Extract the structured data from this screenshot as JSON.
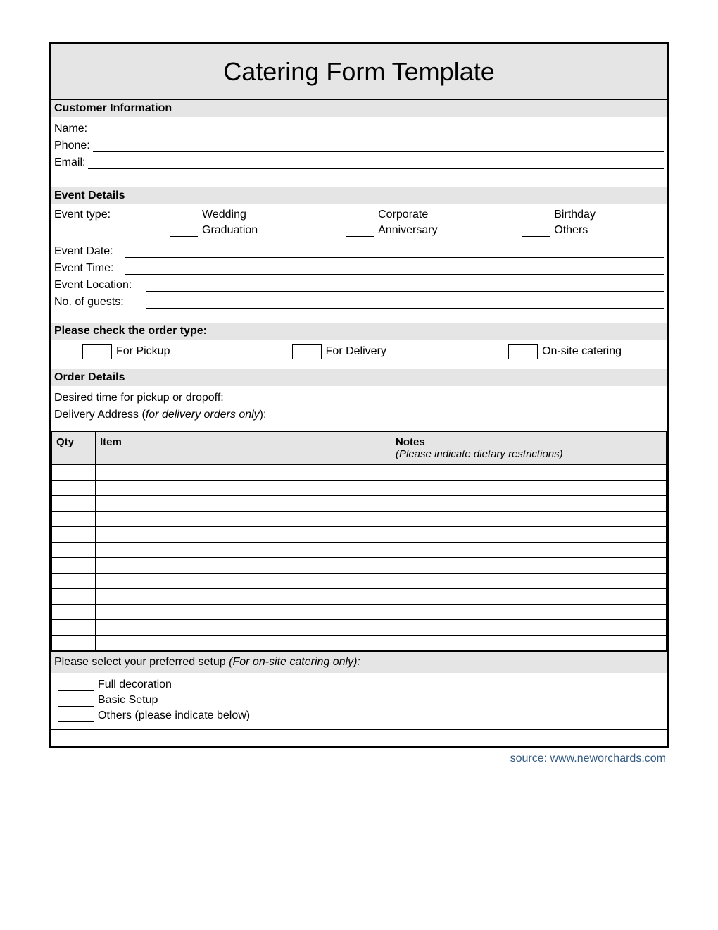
{
  "title": "Catering Form Template",
  "customer": {
    "heading": "Customer Information",
    "name_label": "Name:",
    "phone_label": "Phone:",
    "email_label": "Email:"
  },
  "event": {
    "heading": "Event Details",
    "type_label": "Event type:",
    "types": [
      "Wedding",
      "Corporate",
      "Birthday",
      "Graduation",
      "Anniversary",
      "Others"
    ],
    "date_label": "Event Date:",
    "time_label": "Event Time:",
    "location_label": "Event Location:",
    "guests_label": "No. of guests:"
  },
  "ordertype": {
    "heading": "Please check the order type:",
    "options": [
      "For Pickup",
      "For Delivery",
      "On-site catering"
    ]
  },
  "orderdetails": {
    "heading": "Order Details",
    "time_label": "Desired time for pickup or dropoff:",
    "address_label_prefix": "Delivery Address (",
    "address_label_italic": "for delivery orders only",
    "address_label_suffix": "):"
  },
  "table": {
    "qty": "Qty",
    "item": "Item",
    "notes": "Notes",
    "notes_sub": "(Please indicate dietary restrictions)",
    "rows": 12
  },
  "setup": {
    "heading_prefix": "Please select your preferred setup ",
    "heading_italic": "(For on-site catering only):",
    "options": [
      "Full decoration",
      "Basic Setup",
      "Others (please indicate below)"
    ]
  },
  "source": "source: www.neworchards.com"
}
